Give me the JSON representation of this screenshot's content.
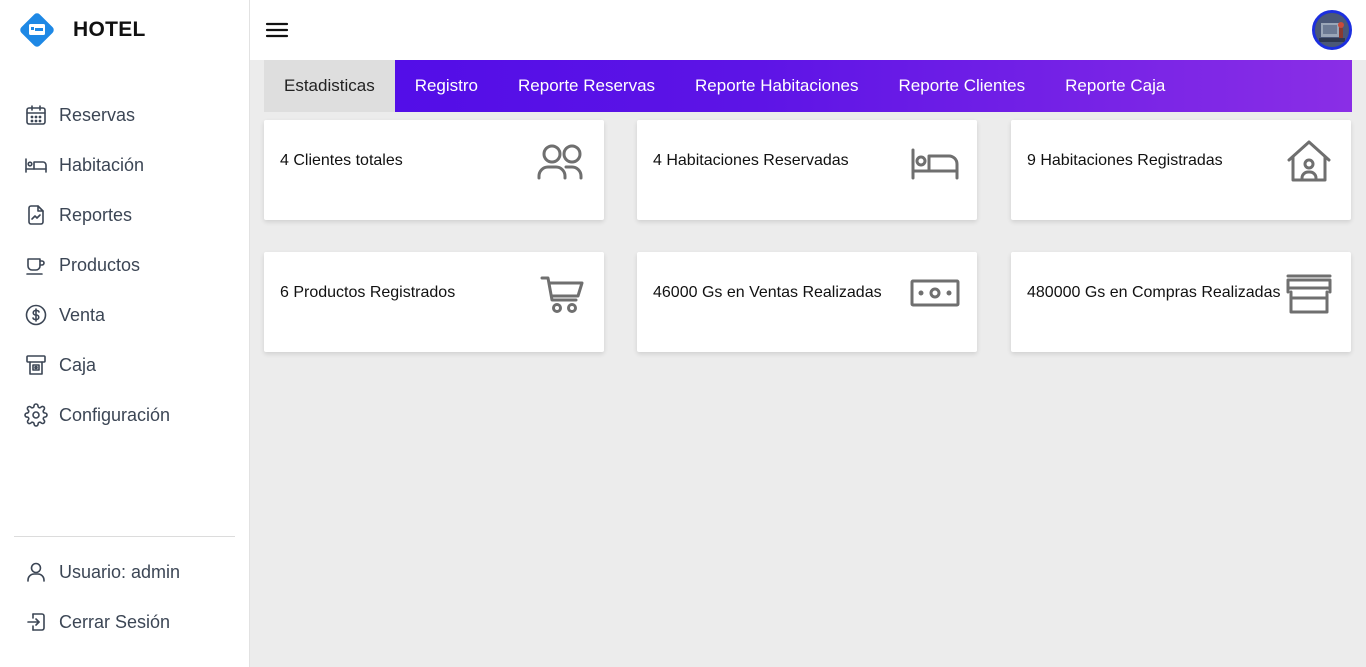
{
  "brand": {
    "name": "HOTEL",
    "logo_color": "#1e88e5"
  },
  "sidebar": {
    "items": [
      {
        "label": "Reservas",
        "icon": "calendar-icon"
      },
      {
        "label": "Habitación",
        "icon": "bed-icon"
      },
      {
        "label": "Reportes",
        "icon": "report-icon"
      },
      {
        "label": "Productos",
        "icon": "cup-icon"
      },
      {
        "label": "Venta",
        "icon": "dollar-icon"
      },
      {
        "label": "Caja",
        "icon": "cash-register-icon"
      },
      {
        "label": "Configuración",
        "icon": "gear-icon"
      }
    ],
    "bottom": [
      {
        "label": "Usuario: admin",
        "icon": "user-icon"
      },
      {
        "label": "Cerrar Sesión",
        "icon": "logout-icon"
      }
    ]
  },
  "topbar": {
    "menu_icon": "hamburger-icon",
    "avatar": "user-avatar"
  },
  "tabs": [
    {
      "label": "Estadisticas",
      "active": true
    },
    {
      "label": "Registro",
      "active": false
    },
    {
      "label": "Reporte Reservas",
      "active": false
    },
    {
      "label": "Reporte Habitaciones",
      "active": false
    },
    {
      "label": "Reporte Clientes",
      "active": false
    },
    {
      "label": "Reporte Caja",
      "active": false
    }
  ],
  "stats": [
    {
      "label": "4 Clientes totales",
      "icon": "users-icon"
    },
    {
      "label": "4 Habitaciones Reservadas",
      "icon": "bed-icon"
    },
    {
      "label": "9 Habitaciones Registradas",
      "icon": "house-user-icon"
    },
    {
      "label": "6 Productos Registrados",
      "icon": "cart-icon"
    },
    {
      "label": "46000 Gs en Ventas Realizadas",
      "icon": "cash-icon"
    },
    {
      "label": "480000 Gs en Compras Realizadas",
      "icon": "store-icon"
    }
  ],
  "colors": {
    "tab_gradient_start": "#4f0be8",
    "tab_gradient_end": "#8a2ee6",
    "active_tab_bg": "#dedede",
    "page_bg": "#ececec",
    "icon_gray": "#6f6f6f",
    "avatar_border": "#1c2fe0"
  }
}
